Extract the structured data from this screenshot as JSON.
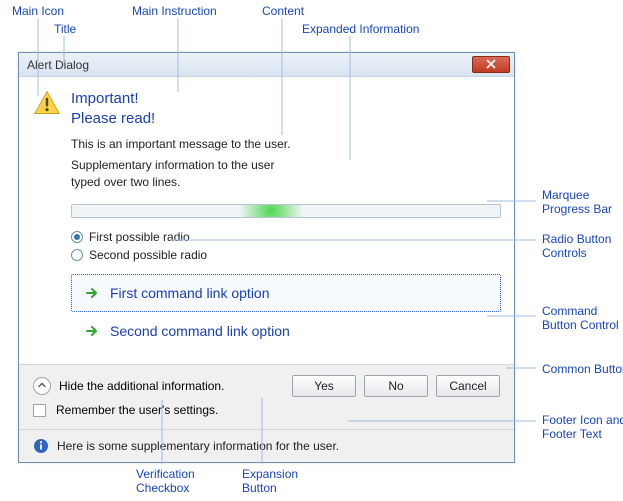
{
  "callouts": {
    "main_icon": "Main Icon",
    "title": "Title",
    "main_instruction": "Main Instruction",
    "content": "Content",
    "expanded_info": "Expanded Information",
    "marquee": "Marquee\nProgress Bar",
    "radios": "Radio Button\nControls",
    "cmdbtn": "Command\nButton Control",
    "common_buttons": "Common Buttons",
    "footer": "Footer Icon and\nFooter Text",
    "verification": "Verification\nCheckbox",
    "expansion": "Expansion\nButton"
  },
  "dialog": {
    "title": "Alert Dialog",
    "main_instruction_line1": "Important!",
    "main_instruction_line2": "Please read!",
    "content_text": "This is an important message to the user.",
    "supplementary_text": "Supplementary information to the user typed over two lines.",
    "radios": [
      {
        "label": "First possible radio",
        "checked": true
      },
      {
        "label": "Second possible radio",
        "checked": false
      }
    ],
    "command_links": [
      {
        "label": "First command link option",
        "focused": true
      },
      {
        "label": "Second command link option",
        "focused": false
      }
    ],
    "expand_label": "Hide the additional information.",
    "verify_label": "Remember the user's settings.",
    "buttons": {
      "yes": "Yes",
      "no": "No",
      "cancel": "Cancel"
    },
    "footer_text": "Here is some supplementary information for the user."
  }
}
